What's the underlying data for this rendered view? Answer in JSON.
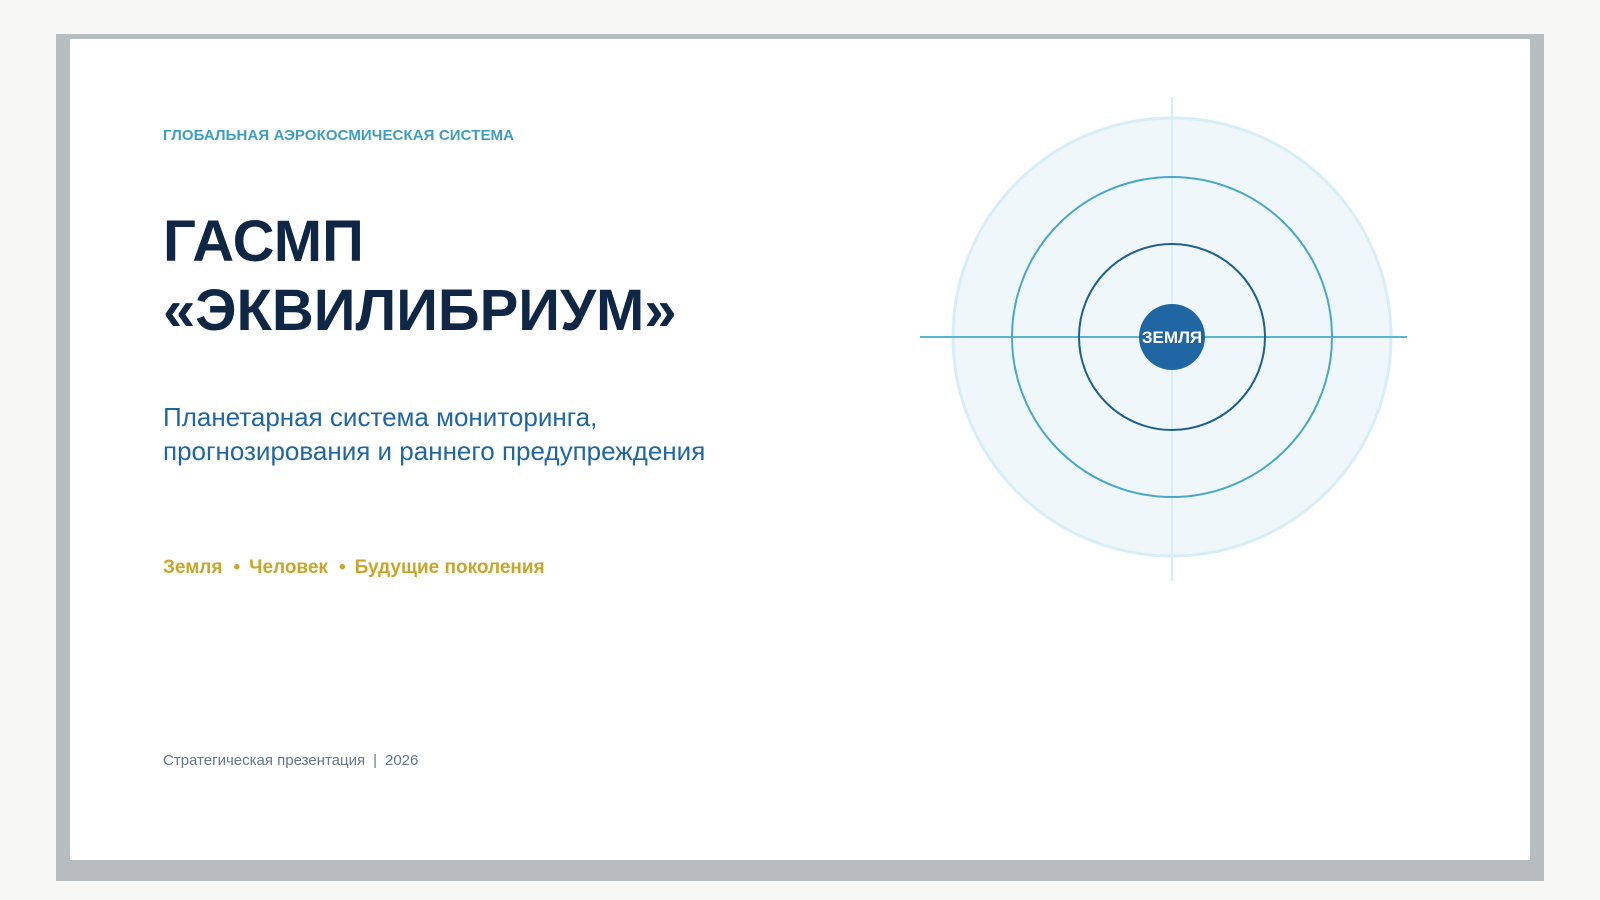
{
  "slide": {
    "kicker": "ГЛОБАЛЬНАЯ АЭРОКОСМИЧЕСКАЯ СИСТЕМА",
    "title_lines": [
      "ГАСМП",
      "«ЭКВИЛИБРИУМ»"
    ],
    "subtitle_lines": [
      "Планетарная система мониторинга,",
      "прогнозирования и раннего предупреждения"
    ],
    "pillars": [
      "Земля",
      "Человек",
      "Будущие поколения"
    ],
    "pillar_separator": "•",
    "footer": {
      "label": "Стратегическая презентация",
      "separator": "|",
      "year": "2026"
    },
    "diagram": {
      "center_label": "ЗЕМЛЯ"
    }
  },
  "colors": {
    "frame": "#b7bcbe",
    "title": "#0f2744",
    "kicker": "#3d9fbd",
    "subtitle": "#1f66a3",
    "pillars": "#c8a52b",
    "footer": "#667786",
    "earth": "#1f66a3"
  }
}
